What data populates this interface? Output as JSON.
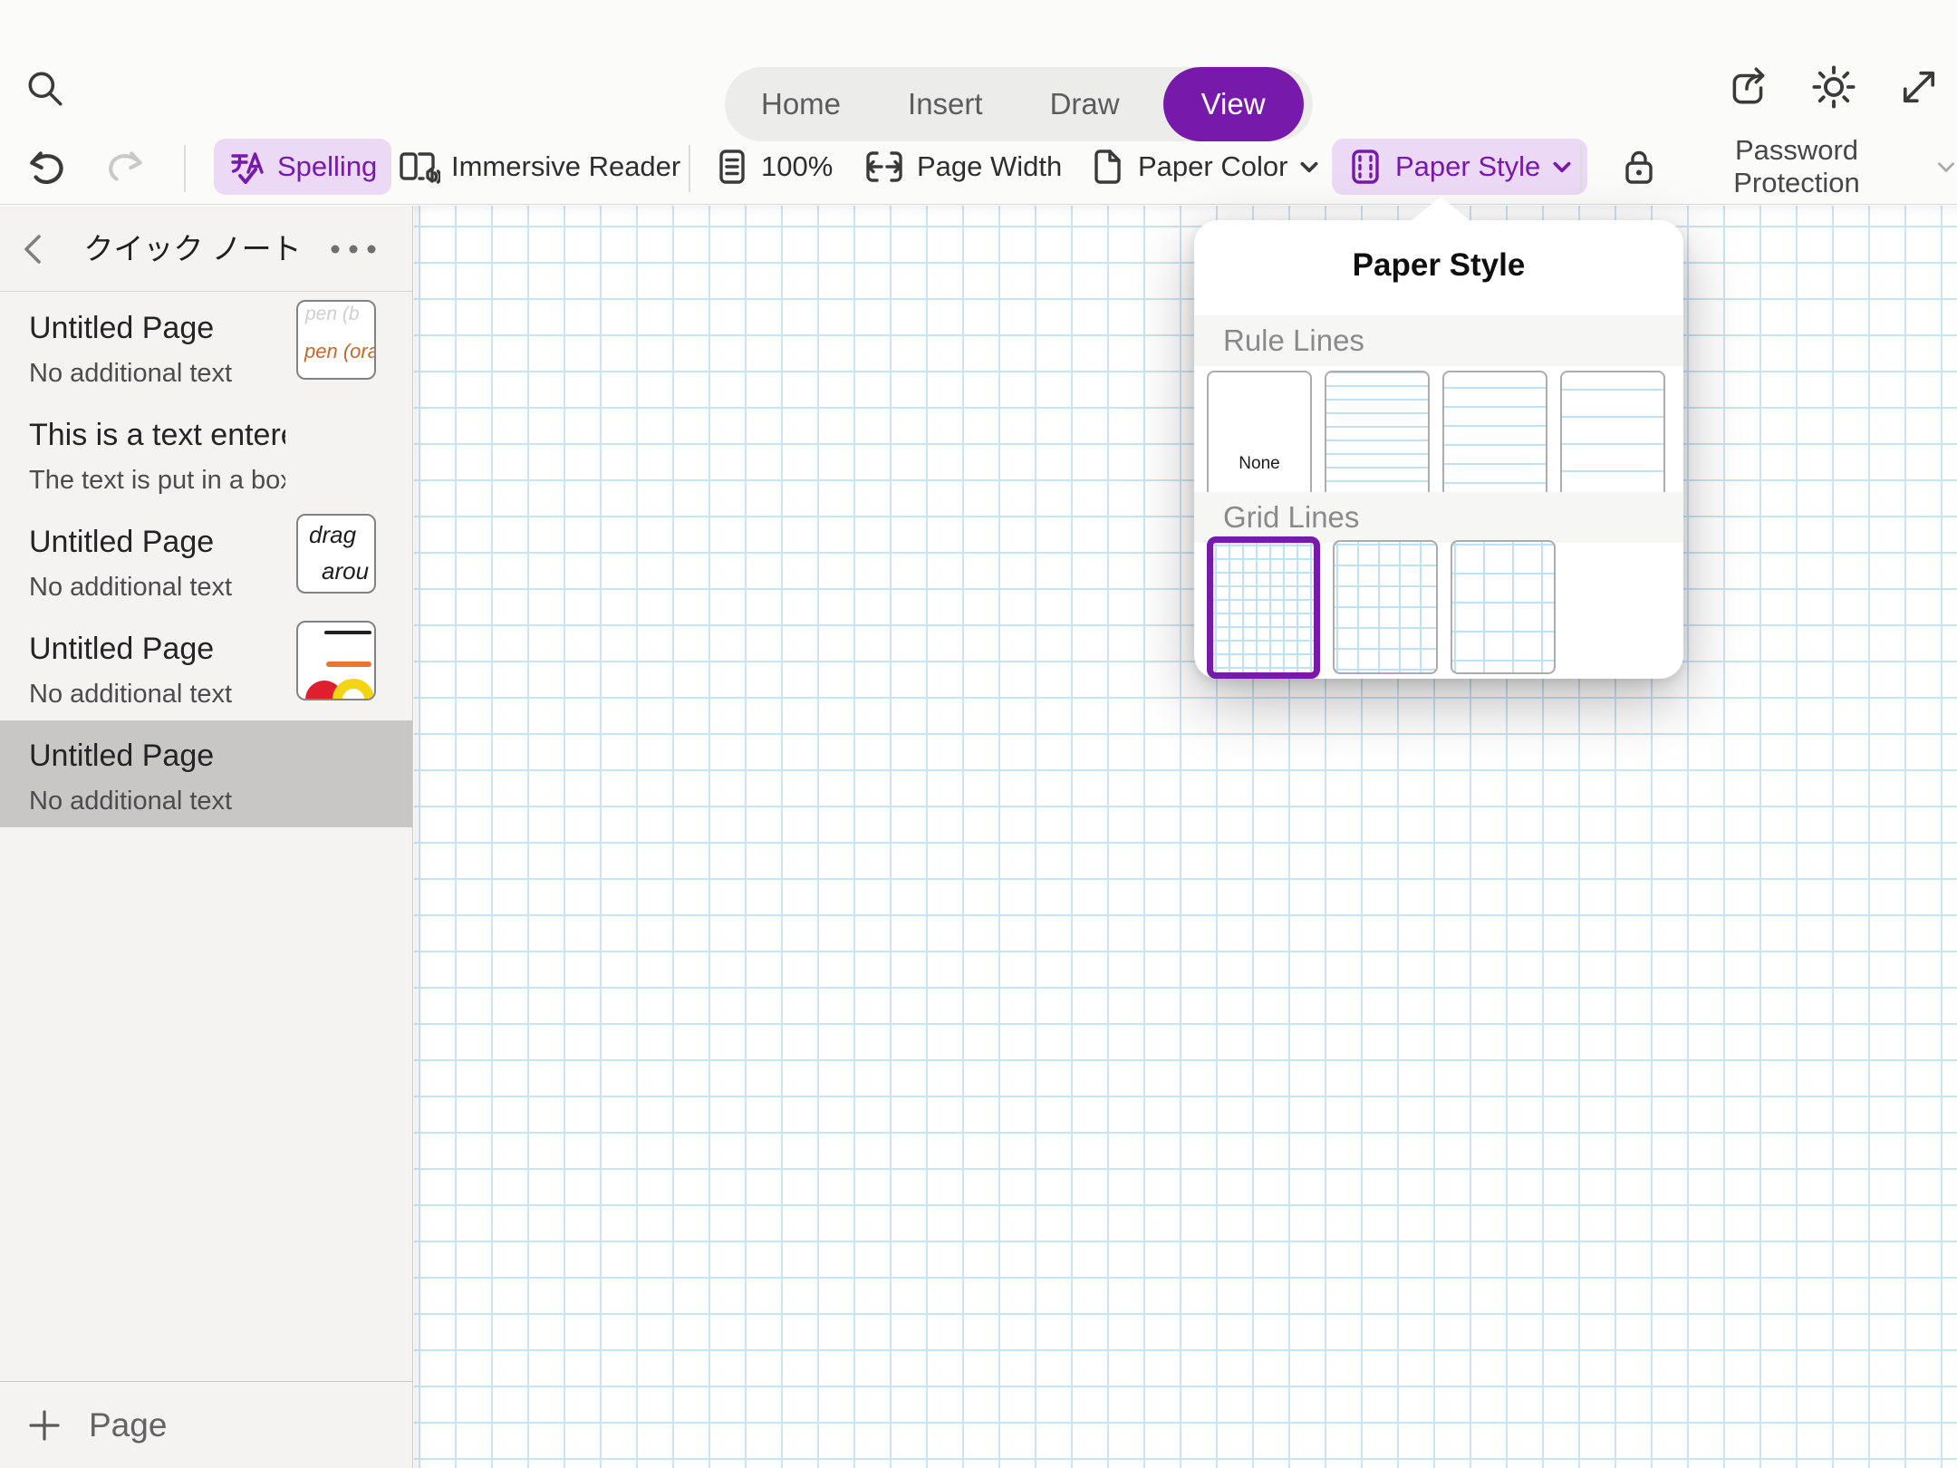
{
  "topbar": {
    "tabs": [
      {
        "label": "Home",
        "active": false
      },
      {
        "label": "Insert",
        "active": false
      },
      {
        "label": "Draw",
        "active": false
      },
      {
        "label": "View",
        "active": true
      }
    ]
  },
  "toolbar": {
    "spelling_label": "Spelling",
    "immersive_reader_label": "Immersive Reader",
    "zoom_label": "100%",
    "page_width_label": "Page Width",
    "paper_color_label": "Paper Color",
    "paper_style_label": "Paper Style",
    "password_protection_label": "Password Protection"
  },
  "sidebar": {
    "title": "クイック ノート",
    "add_page_label": "Page",
    "pages": [
      {
        "title": "Untitled Page",
        "subtitle": "No additional text",
        "thumb": "pen",
        "thumb_lines": [
          "pen (b",
          "pen (ora"
        ],
        "selected": false
      },
      {
        "title": "This is a text entered in...",
        "subtitle": "The text is put in a box called...",
        "thumb": "none",
        "selected": false
      },
      {
        "title": "Untitled Page",
        "subtitle": "No additional text",
        "thumb": "drag",
        "thumb_lines": [
          "drag",
          "arou"
        ],
        "selected": false
      },
      {
        "title": "Untitled Page",
        "subtitle": "No additional text",
        "thumb": "shapes",
        "selected": false
      },
      {
        "title": "Untitled Page",
        "subtitle": "No additional text",
        "thumb": "none",
        "selected": true
      }
    ]
  },
  "popover": {
    "title": "Paper Style",
    "rule_section": "Rule Lines",
    "grid_section": "Grid Lines",
    "rule_options": [
      {
        "id": "none",
        "label": "None",
        "selected": false
      },
      {
        "id": "narrow",
        "selected": false
      },
      {
        "id": "college",
        "selected": false
      },
      {
        "id": "wide",
        "selected": false
      }
    ],
    "grid_options": [
      {
        "id": "small",
        "selected": true
      },
      {
        "id": "medium",
        "selected": false
      },
      {
        "id": "large",
        "selected": false
      }
    ]
  },
  "colors": {
    "accent": "#7719AA",
    "accent_soft": "#EBD9F5",
    "paper_line": "#C6E5F7",
    "tile_line": "#BEE1F3",
    "selected_item_bg": "#C8C7C5"
  }
}
